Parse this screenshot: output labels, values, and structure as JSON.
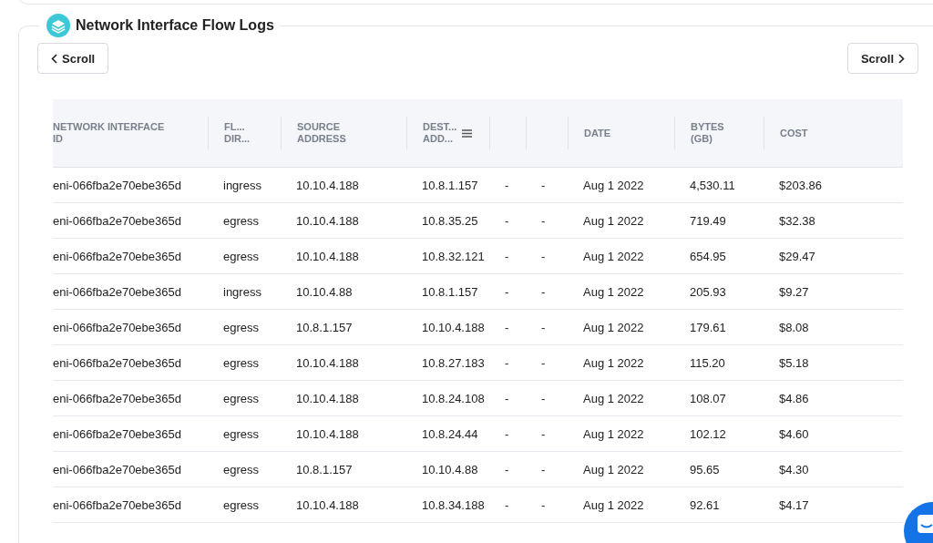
{
  "section": {
    "title": "Network Interface Flow Logs"
  },
  "scroll_buttons": [
    {
      "label": "Scroll",
      "kind": "back"
    },
    {
      "label": "Scroll",
      "kind": "forward"
    }
  ],
  "table": {
    "columns": [
      {
        "label": "NETWORK INTERFACE\nID",
        "has_menu": false
      },
      {
        "label": "FL...\nDIR...",
        "has_menu": false
      },
      {
        "label": "SOURCE\nADDRESS",
        "has_menu": false
      },
      {
        "label": "DEST...\nADD...",
        "has_menu": true
      },
      {
        "has_menu": false
      },
      {
        "has_menu": false
      },
      {
        "label": "DATE",
        "has_menu": false
      },
      {
        "label": "BYTES\n(GB)",
        "has_menu": false
      },
      {
        "label": "COST",
        "has_menu": false
      }
    ],
    "rows": [
      [
        "eni-066fba2e70ebe365d",
        "ingress",
        "10.10.4.188",
        "10.8.1.157",
        "-",
        "-",
        "Aug 1 2022",
        "4,530.11",
        "$203.86"
      ],
      [
        "eni-066fba2e70ebe365d",
        "egress",
        "10.10.4.188",
        "10.8.35.25",
        "-",
        "-",
        "Aug 1 2022",
        "719.49",
        "$32.38"
      ],
      [
        "eni-066fba2e70ebe365d",
        "egress",
        "10.10.4.188",
        "10.8.32.121",
        "-",
        "-",
        "Aug 1 2022",
        "654.95",
        "$29.47"
      ],
      [
        "eni-066fba2e70ebe365d",
        "ingress",
        "10.10.4.88",
        "10.8.1.157",
        "-",
        "-",
        "Aug 1 2022",
        "205.93",
        "$9.27"
      ],
      [
        "eni-066fba2e70ebe365d",
        "egress",
        "10.8.1.157",
        "10.10.4.188",
        "-",
        "-",
        "Aug 1 2022",
        "179.61",
        "$8.08"
      ],
      [
        "eni-066fba2e70ebe365d",
        "egress",
        "10.10.4.188",
        "10.8.27.183",
        "-",
        "-",
        "Aug 1 2022",
        "115.20",
        "$5.18"
      ],
      [
        "eni-066fba2e70ebe365d",
        "egress",
        "10.10.4.188",
        "10.8.24.108",
        "-",
        "-",
        "Aug 1 2022",
        "108.07",
        "$4.86"
      ],
      [
        "eni-066fba2e70ebe365d",
        "egress",
        "10.10.4.188",
        "10.8.24.44",
        "-",
        "-",
        "Aug 1 2022",
        "102.12",
        "$4.60"
      ],
      [
        "eni-066fba2e70ebe365d",
        "egress",
        "10.8.1.157",
        "10.10.4.88",
        "-",
        "-",
        "Aug 1 2022",
        "95.65",
        "$4.30"
      ],
      [
        "eni-066fba2e70ebe365d",
        "egress",
        "10.10.4.188",
        "10.8.34.188",
        "-",
        "-",
        "Aug 1 2022",
        "92.61",
        "$4.17"
      ]
    ]
  }
}
